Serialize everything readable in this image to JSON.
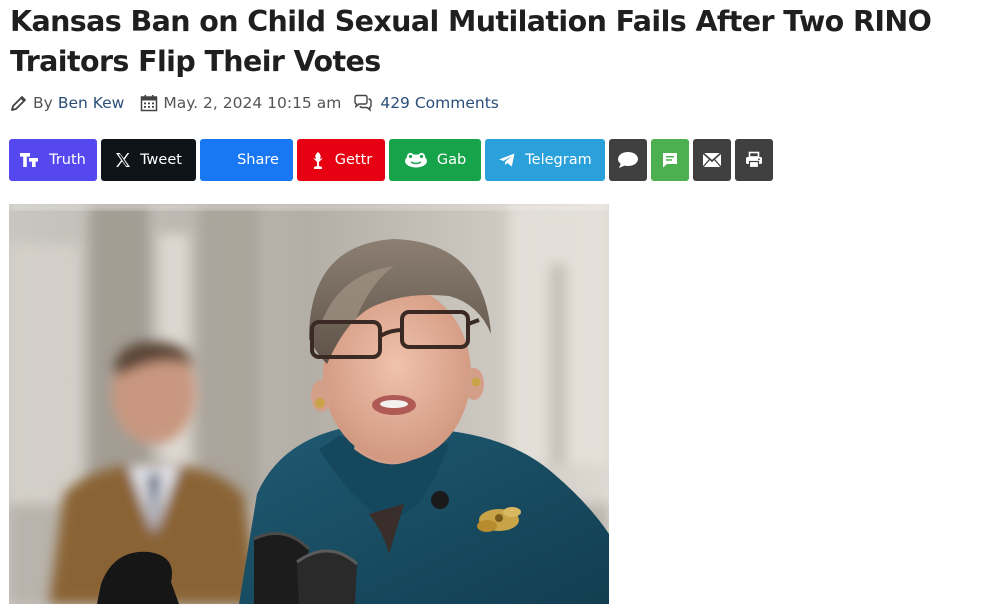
{
  "article": {
    "title": "Kansas Ban on Child Sexual Mutilation Fails After Two RINO Traitors Flip Their Votes",
    "byline_prefix": "By",
    "author": "Ben Kew",
    "date": "May. 2, 2024 10:15 am",
    "comments": "429 Comments"
  },
  "share_buttons": [
    {
      "label": "Truth",
      "color": "#5448ee",
      "icon": "truth-social-icon"
    },
    {
      "label": "Tweet",
      "color": "#0f1419",
      "icon": "x-icon"
    },
    {
      "label": "Share",
      "color": "#1877f2",
      "icon": "facebook-icon"
    },
    {
      "label": "Gettr",
      "color": "#e60012",
      "icon": "gettr-icon"
    },
    {
      "label": "Gab",
      "color": "#16a34a",
      "icon": "gab-icon"
    },
    {
      "label": "Telegram",
      "color": "#2aa1da",
      "icon": "telegram-icon"
    },
    {
      "label": "",
      "color": "#3f3f3f",
      "icon": "comment-icon"
    },
    {
      "label": "",
      "color": "#4caf50",
      "icon": "sms-icon"
    },
    {
      "label": "",
      "color": "#3f3f3f",
      "icon": "email-icon"
    },
    {
      "label": "",
      "color": "#3f3f3f",
      "icon": "print-icon"
    }
  ],
  "colors": {
    "title": "#1f1f1f",
    "link": "#2b4f7a",
    "meta": "#555555"
  }
}
